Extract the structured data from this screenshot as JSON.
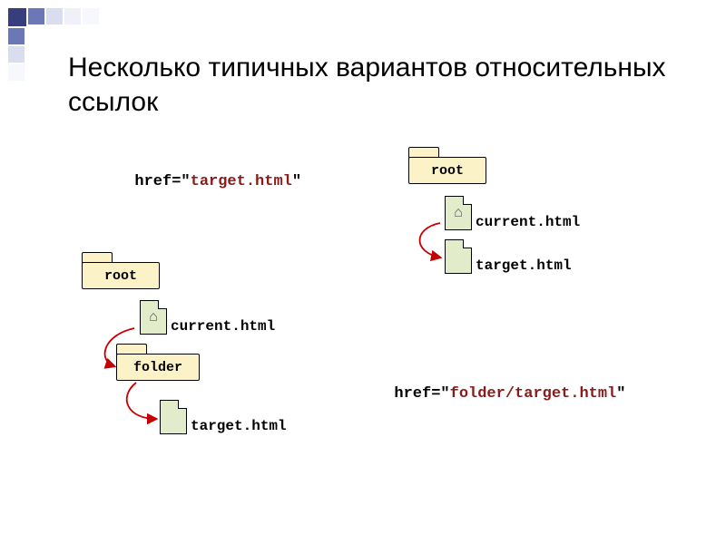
{
  "title": "Несколько типичных вариантов относительных ссылок",
  "example1": {
    "href_label": "href=\"",
    "href_value": "target.html",
    "href_close": "\"",
    "folder_root": "root",
    "file_current": "current.html",
    "file_target": "target.html"
  },
  "example2": {
    "href_label": "href=\"",
    "href_value": "folder/target.html",
    "href_close": "\"",
    "folder_root": "root",
    "folder_sub": "folder",
    "file_current": "current.html",
    "file_target": "target.html"
  }
}
